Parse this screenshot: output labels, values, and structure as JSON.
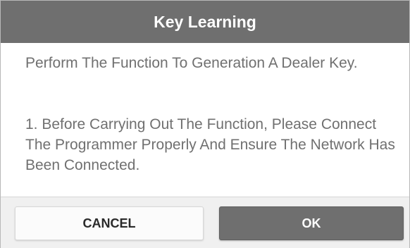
{
  "dialog": {
    "title": "Key Learning",
    "paragraph_1": "Perform The Function To Generation A Dealer Key.",
    "paragraph_2": "1. Before Carrying Out The Function, Please Connect The Programmer Properly And Ensure The Network Has Been Connected.",
    "buttons": {
      "cancel_label": "CANCEL",
      "ok_label": "OK"
    }
  },
  "colors": {
    "header_bg": "#6f6f6f",
    "body_text": "#707070",
    "ok_button_bg": "#6f6f6f",
    "cancel_button_bg": "#fbfbfb",
    "footer_bg": "#f0f0f0"
  }
}
